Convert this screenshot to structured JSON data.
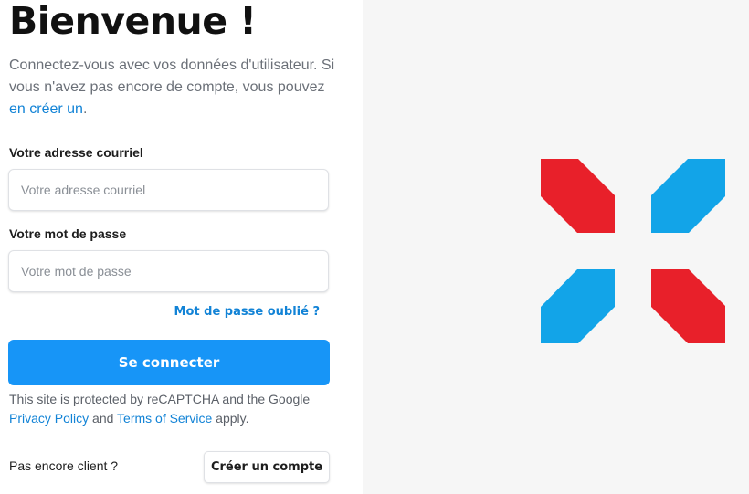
{
  "login": {
    "title": "Bienvenue !",
    "intro_text": "Connectez-vous avec vos données d'utilisateur. Si vous n'avez pas encore de compte, vous pouvez ",
    "intro_link": "en créer un",
    "intro_end": ".",
    "email": {
      "label": "Votre adresse courriel",
      "placeholder": "Votre adresse courriel",
      "value": ""
    },
    "password": {
      "label": "Votre mot de passe",
      "placeholder": "Votre mot de passe",
      "value": ""
    },
    "forgot_password": "Mot de passe oublié ?",
    "submit_label": "Se connecter",
    "recaptcha": {
      "text_start": "This site is protected by reCAPTCHA and the Google ",
      "privacy_link": "Privacy Policy",
      "and": " and ",
      "terms_link": "Terms of Service",
      "text_end": " apply."
    },
    "no_account_text": "Pas encore client ?",
    "create_account_label": "Créer un compte"
  },
  "brand": {
    "logo_icon": "x-shaped-brand-logo",
    "color_red": "#e8202a",
    "color_blue": "#12a4e8"
  },
  "colors": {
    "accent": "#1795f7",
    "link": "#1283d6",
    "panel_background": "#f6f6f6"
  }
}
